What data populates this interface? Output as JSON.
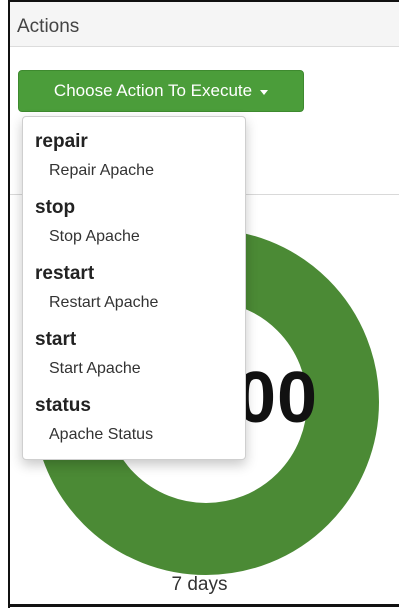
{
  "panel": {
    "title": "Actions"
  },
  "button": {
    "label": "Choose Action To Execute",
    "color": "#4b9d3a"
  },
  "dropdown": {
    "items": [
      {
        "name": "repair",
        "description": "Repair Apache"
      },
      {
        "name": "stop",
        "description": "Stop Apache"
      },
      {
        "name": "restart",
        "description": "Restart Apache"
      },
      {
        "name": "start",
        "description": "Start Apache"
      },
      {
        "name": "status",
        "description": "Apache Status"
      }
    ]
  },
  "gauge": {
    "value_text": "00",
    "period": "7 days",
    "color": "#4b8a35"
  }
}
